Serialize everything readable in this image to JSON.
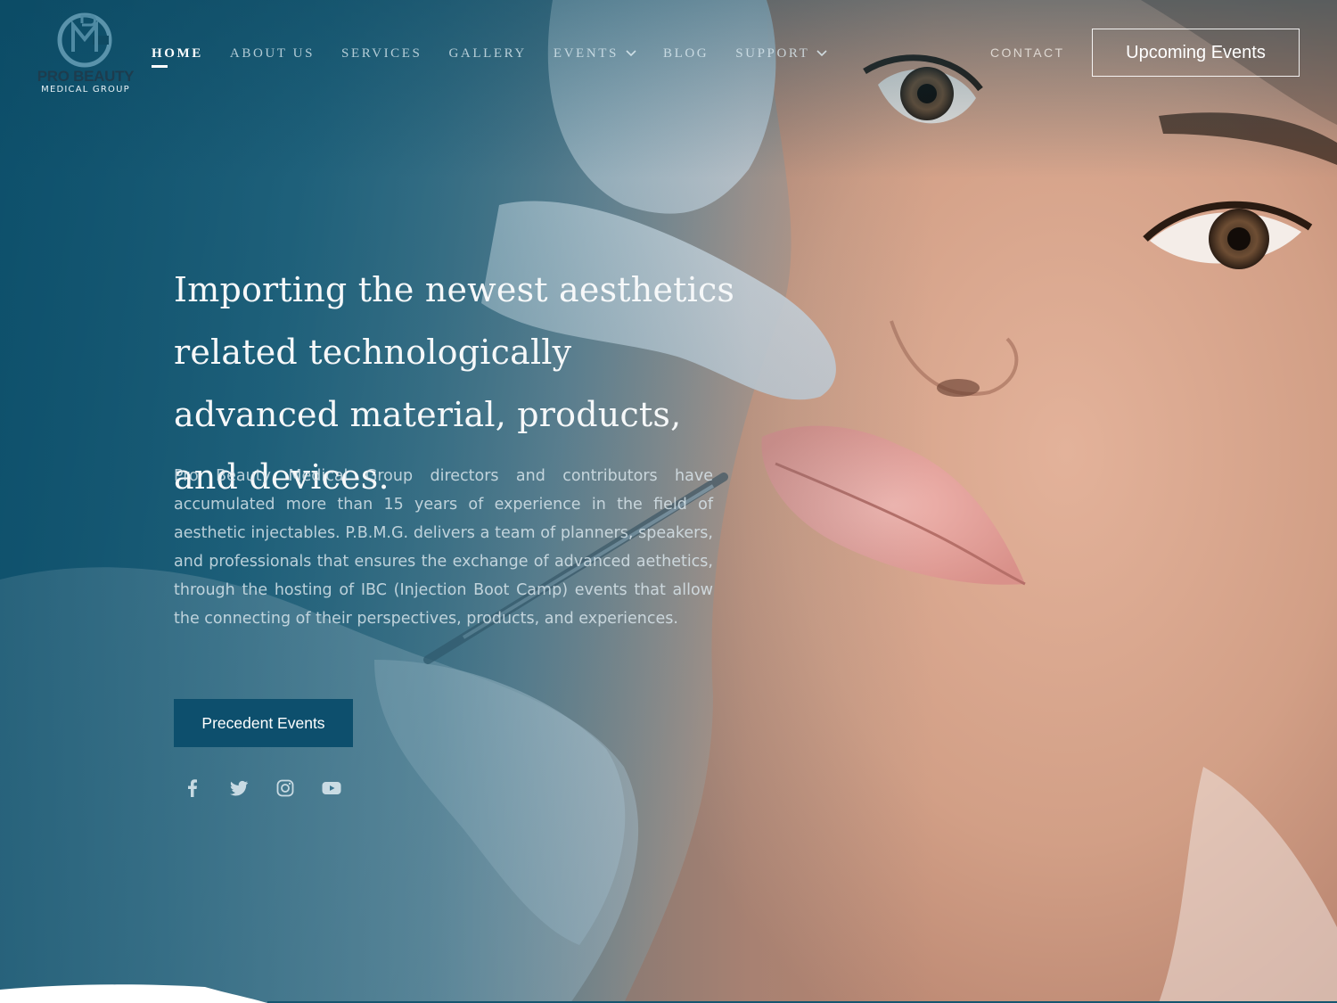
{
  "brand": {
    "logo_monogram": "MPG",
    "line1": "PRO BEAUTY",
    "line2": "MEDICAL GROUP",
    "colors": {
      "teal": "#0d4f6d",
      "logo_blue": "#4f8aa3",
      "logo_dark": "#1d3c4e"
    }
  },
  "nav": {
    "items": [
      {
        "label": "HOME",
        "active": true,
        "dropdown": false
      },
      {
        "label": "ABOUT US",
        "active": false,
        "dropdown": false
      },
      {
        "label": "SERVICES",
        "active": false,
        "dropdown": false
      },
      {
        "label": "GALLERY",
        "active": false,
        "dropdown": false
      },
      {
        "label": "EVENTS",
        "active": false,
        "dropdown": true
      },
      {
        "label": "BLOG",
        "active": false,
        "dropdown": false
      },
      {
        "label": "SUPPORT",
        "active": false,
        "dropdown": true
      }
    ],
    "contact_label": "CONTACT",
    "cta_label": "Upcoming Events"
  },
  "hero": {
    "headline": "Importing the newest aesthetics related technologically advanced material, products, and devices.",
    "intro": "Pro Beauty Medical Group directors and contributors have accumulated more than 15 years of experience in the field of aesthetic injectables. P.B.M.G. delivers a team of planners, speakers, and professionals that ensures the exchange of advanced aethetics, through the hosting of IBC (Injection Boot Camp) events that allow the connecting of their perspectives, products, and experiences.",
    "button_label": "Precedent Events"
  },
  "social": [
    {
      "icon": "facebook-icon"
    },
    {
      "icon": "twitter-icon"
    },
    {
      "icon": "instagram-icon"
    },
    {
      "icon": "youtube-icon"
    }
  ]
}
